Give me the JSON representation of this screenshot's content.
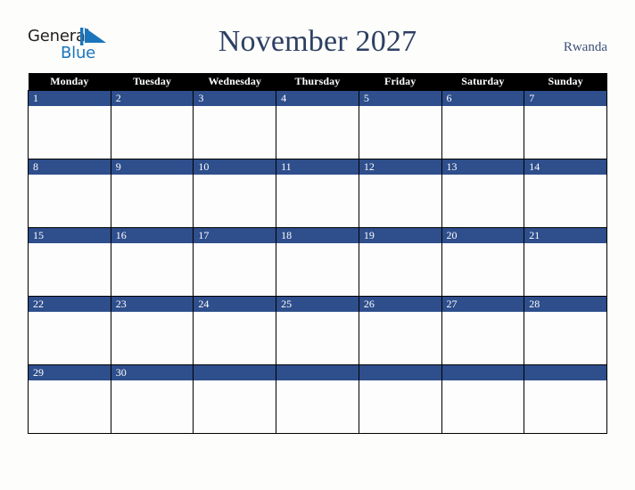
{
  "brand": {
    "word_one": "General",
    "word_two": "Blue",
    "triangle_icon": "blue-triangle-icon",
    "triangle_color": "#1b75bc",
    "text_color": "#231f20"
  },
  "header": {
    "title": "November 2027",
    "country": "Rwanda",
    "title_color": "#2d3f63"
  },
  "colors": {
    "page_background": "#fdfdfb",
    "weekday_header_background": "#000000",
    "weekday_header_text": "#ffffff",
    "date_bar_background": "#2e4e8c",
    "date_bar_text": "#ffffff",
    "cell_background": "#fdfdfd",
    "grid_border": "#000000"
  },
  "weekdays": [
    "Monday",
    "Tuesday",
    "Wednesday",
    "Thursday",
    "Friday",
    "Saturday",
    "Sunday"
  ],
  "weeks": [
    [
      "1",
      "2",
      "3",
      "4",
      "5",
      "6",
      "7"
    ],
    [
      "8",
      "9",
      "10",
      "11",
      "12",
      "13",
      "14"
    ],
    [
      "15",
      "16",
      "17",
      "18",
      "19",
      "20",
      "21"
    ],
    [
      "22",
      "23",
      "24",
      "25",
      "26",
      "27",
      "28"
    ],
    [
      "29",
      "30",
      "",
      "",
      "",
      "",
      ""
    ]
  ]
}
